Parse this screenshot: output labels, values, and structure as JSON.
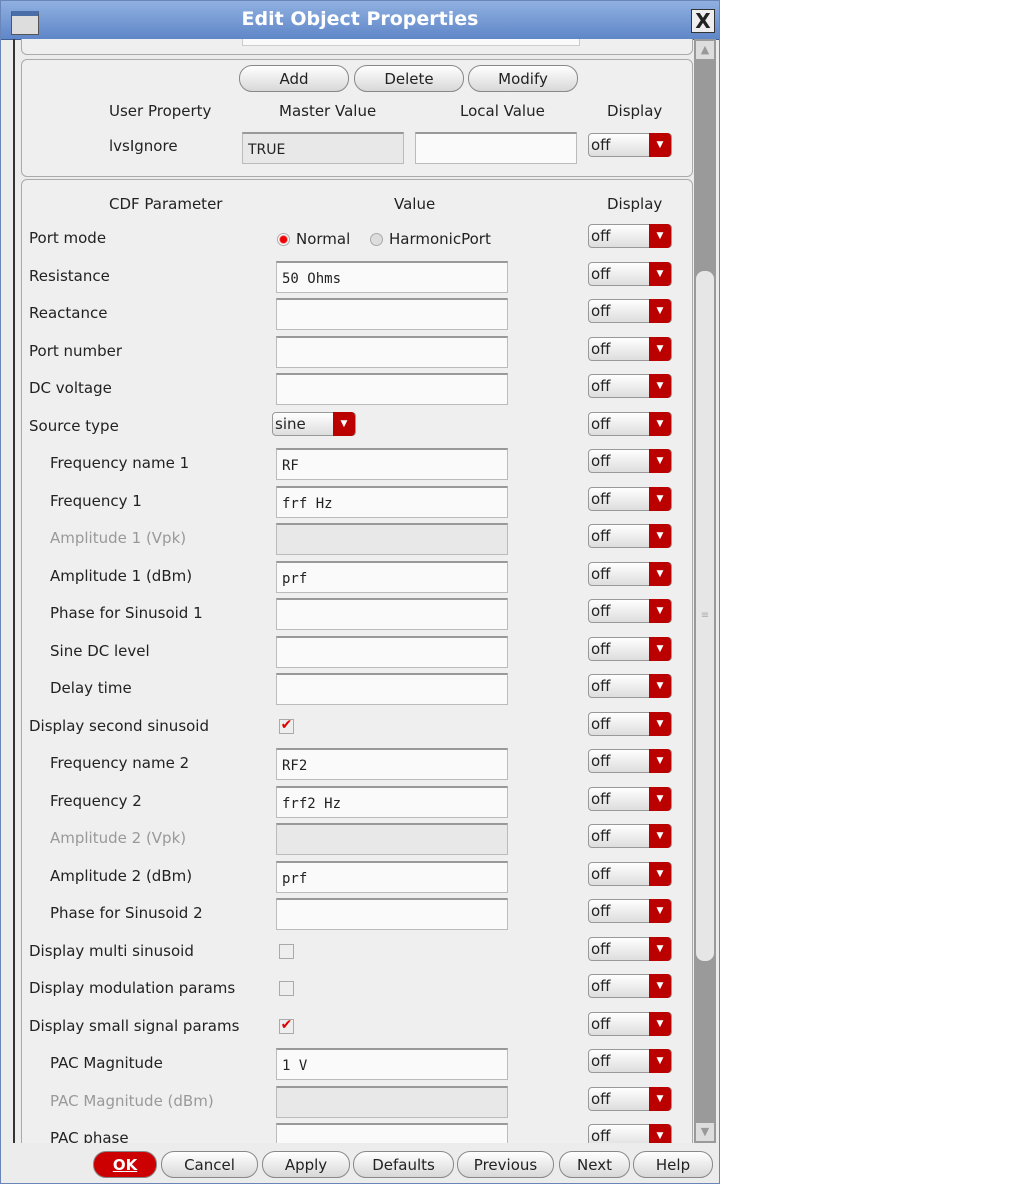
{
  "window": {
    "title": "Edit Object Properties",
    "close": "X"
  },
  "user_props": {
    "buttons": [
      "Add",
      "Delete",
      "Modify"
    ],
    "headers": [
      "User Property",
      "Master Value",
      "Local Value",
      "Display"
    ],
    "row": {
      "name": "lvsIgnore",
      "master": "TRUE",
      "local": "",
      "display": "off"
    }
  },
  "cdf": {
    "headers": [
      "CDF Parameter",
      "Value",
      "Display"
    ],
    "rows": [
      {
        "label": "Port mode",
        "type": "radio",
        "options": [
          "Normal",
          "HarmonicPort"
        ],
        "selected": "Normal",
        "display": "off"
      },
      {
        "label": "Resistance",
        "type": "text",
        "value": "50 Ohms",
        "display": "off"
      },
      {
        "label": "Reactance",
        "type": "text",
        "value": "",
        "display": "off"
      },
      {
        "label": "Port number",
        "type": "text",
        "value": "",
        "display": "off"
      },
      {
        "label": "DC voltage",
        "type": "text",
        "value": "",
        "display": "off"
      },
      {
        "label": "Source type",
        "type": "select",
        "value": "sine",
        "display": "off"
      },
      {
        "label": "Frequency name 1",
        "type": "text",
        "value": "RF",
        "display": "off",
        "indent": true
      },
      {
        "label": "Frequency 1",
        "type": "text",
        "value": "frf Hz",
        "display": "off",
        "indent": true
      },
      {
        "label": "Amplitude 1 (Vpk)",
        "type": "text",
        "value": "",
        "display": "off",
        "indent": true,
        "disabled": true
      },
      {
        "label": "Amplitude 1 (dBm)",
        "type": "text",
        "value": "prf",
        "display": "off",
        "indent": true
      },
      {
        "label": "Phase for Sinusoid 1",
        "type": "text",
        "value": "",
        "display": "off",
        "indent": true
      },
      {
        "label": "Sine DC level",
        "type": "text",
        "value": "",
        "display": "off",
        "indent": true
      },
      {
        "label": "Delay time",
        "type": "text",
        "value": "",
        "display": "off",
        "indent": true
      },
      {
        "label": "Display second sinusoid",
        "type": "check",
        "checked": true,
        "display": "off"
      },
      {
        "label": "Frequency name 2",
        "type": "text",
        "value": "RF2",
        "display": "off",
        "indent": true
      },
      {
        "label": "Frequency 2",
        "type": "text",
        "value": "frf2 Hz",
        "display": "off",
        "indent": true
      },
      {
        "label": "Amplitude 2 (Vpk)",
        "type": "text",
        "value": "",
        "display": "off",
        "indent": true,
        "disabled": true
      },
      {
        "label": "Amplitude 2 (dBm)",
        "type": "text",
        "value": "prf",
        "display": "off",
        "indent": true
      },
      {
        "label": "Phase for Sinusoid 2",
        "type": "text",
        "value": "",
        "display": "off",
        "indent": true
      },
      {
        "label": "Display multi sinusoid",
        "type": "check",
        "checked": false,
        "display": "off"
      },
      {
        "label": "Display modulation params",
        "type": "check",
        "checked": false,
        "display": "off"
      },
      {
        "label": "Display small signal params",
        "type": "check",
        "checked": true,
        "display": "off"
      },
      {
        "label": "PAC Magnitude",
        "type": "text",
        "value": "1 V",
        "display": "off",
        "indent": true
      },
      {
        "label": "PAC Magnitude (dBm)",
        "type": "text",
        "value": "",
        "display": "off",
        "indent": true,
        "disabled": true
      },
      {
        "label": "PAC phase",
        "type": "text",
        "value": "",
        "display": "off",
        "indent": true
      }
    ]
  },
  "footer": {
    "buttons": [
      "OK",
      "Cancel",
      "Apply",
      "Defaults",
      "Previous",
      "Next",
      "Help"
    ]
  },
  "colors": {
    "accent": "#b00000",
    "titlebar": "#6f94d0"
  }
}
